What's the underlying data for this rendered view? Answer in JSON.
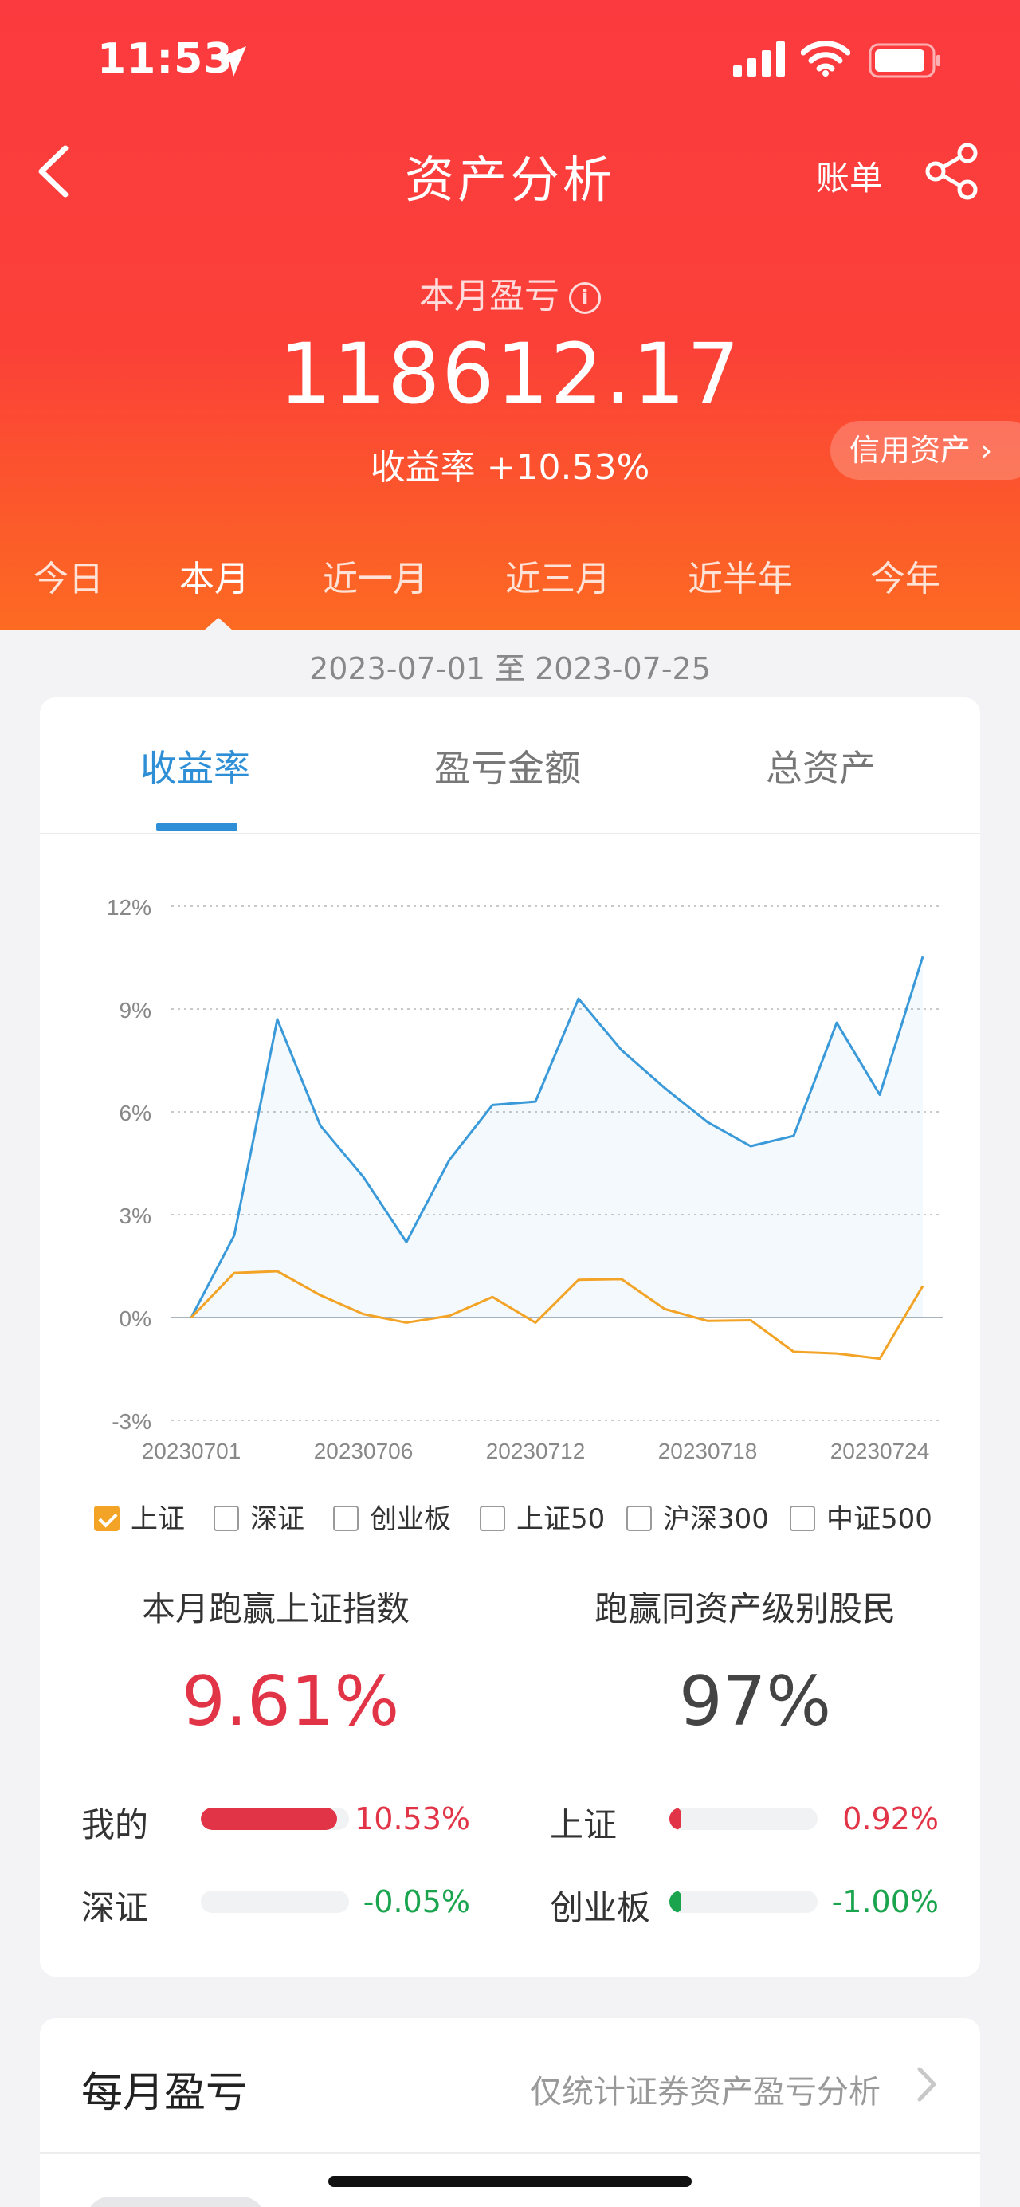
{
  "status": {
    "time": "11:53"
  },
  "header": {
    "title": "资产分析",
    "bill_label": "账单",
    "pl_label": "本月盈亏",
    "pl_value": "118612.17",
    "rate_text": "收益率 +10.53%",
    "credit_label": "信用资产",
    "colors": {
      "gradient_top": "#fb3a3f",
      "gradient_bottom": "#fd6a22"
    }
  },
  "period_tabs": [
    "今日",
    "本月",
    "近一月",
    "近三月",
    "近半年",
    "今年"
  ],
  "active_period": "本月",
  "date_range": "2023-07-01 至 2023-07-25",
  "chart_tabs": [
    "收益率",
    "盈亏金额",
    "总资产"
  ],
  "active_chart_tab": "收益率",
  "chart_data": {
    "type": "line",
    "x": [
      "20230701",
      "20230703",
      "20230704",
      "20230705",
      "20230706",
      "20230707",
      "20230710",
      "20230711",
      "20230712",
      "20230713",
      "20230714",
      "20230717",
      "20230718",
      "20230719",
      "20230720",
      "20230721",
      "20230724",
      "20230725"
    ],
    "x_tick_labels": [
      "20230701",
      "20230706",
      "20230712",
      "20230718",
      "20230724"
    ],
    "y_tick_labels": [
      "12%",
      "9%",
      "6%",
      "3%",
      "0%",
      "-3%"
    ],
    "ylim": [
      -3,
      12
    ],
    "grid": true,
    "series": [
      {
        "name": "我的",
        "color": "#3a9ad9",
        "values": [
          0,
          2.4,
          8.7,
          5.6,
          4.1,
          2.2,
          4.6,
          6.2,
          6.3,
          9.3,
          7.8,
          6.7,
          5.7,
          5.0,
          5.3,
          8.6,
          6.5,
          10.53
        ]
      },
      {
        "name": "上证",
        "color": "#f3a326",
        "values": [
          0,
          1.3,
          1.35,
          0.65,
          0.1,
          -0.15,
          0.05,
          0.6,
          -0.15,
          1.1,
          1.12,
          0.25,
          -0.1,
          -0.08,
          -1.0,
          -1.05,
          -1.2,
          0.92
        ]
      }
    ]
  },
  "legend": [
    {
      "label": "上证",
      "checked": true
    },
    {
      "label": "深证",
      "checked": false
    },
    {
      "label": "创业板",
      "checked": false
    },
    {
      "label": "上证50",
      "checked": false
    },
    {
      "label": "沪深300",
      "checked": false
    },
    {
      "label": "中证500",
      "checked": false
    }
  ],
  "stats": {
    "beat_index_label": "本月跑赢上证指数",
    "beat_index_value": "9.61%",
    "beat_peers_label": "跑赢同资产级别股民",
    "beat_peers_value": "97%"
  },
  "comparisons": [
    {
      "label": "我的",
      "value": "10.53%",
      "fraction": 0.92,
      "sign": "pos"
    },
    {
      "label": "上证",
      "value": "0.92%",
      "fraction": 0.08,
      "sign": "pos"
    },
    {
      "label": "深证",
      "value": "-0.05%",
      "fraction": 0.0,
      "sign": "neg"
    },
    {
      "label": "创业板",
      "value": "-1.00%",
      "fraction": 0.08,
      "sign": "neg"
    }
  ],
  "monthly": {
    "title": "每月盈亏",
    "note": "仅统计证券资产盈亏分析"
  }
}
